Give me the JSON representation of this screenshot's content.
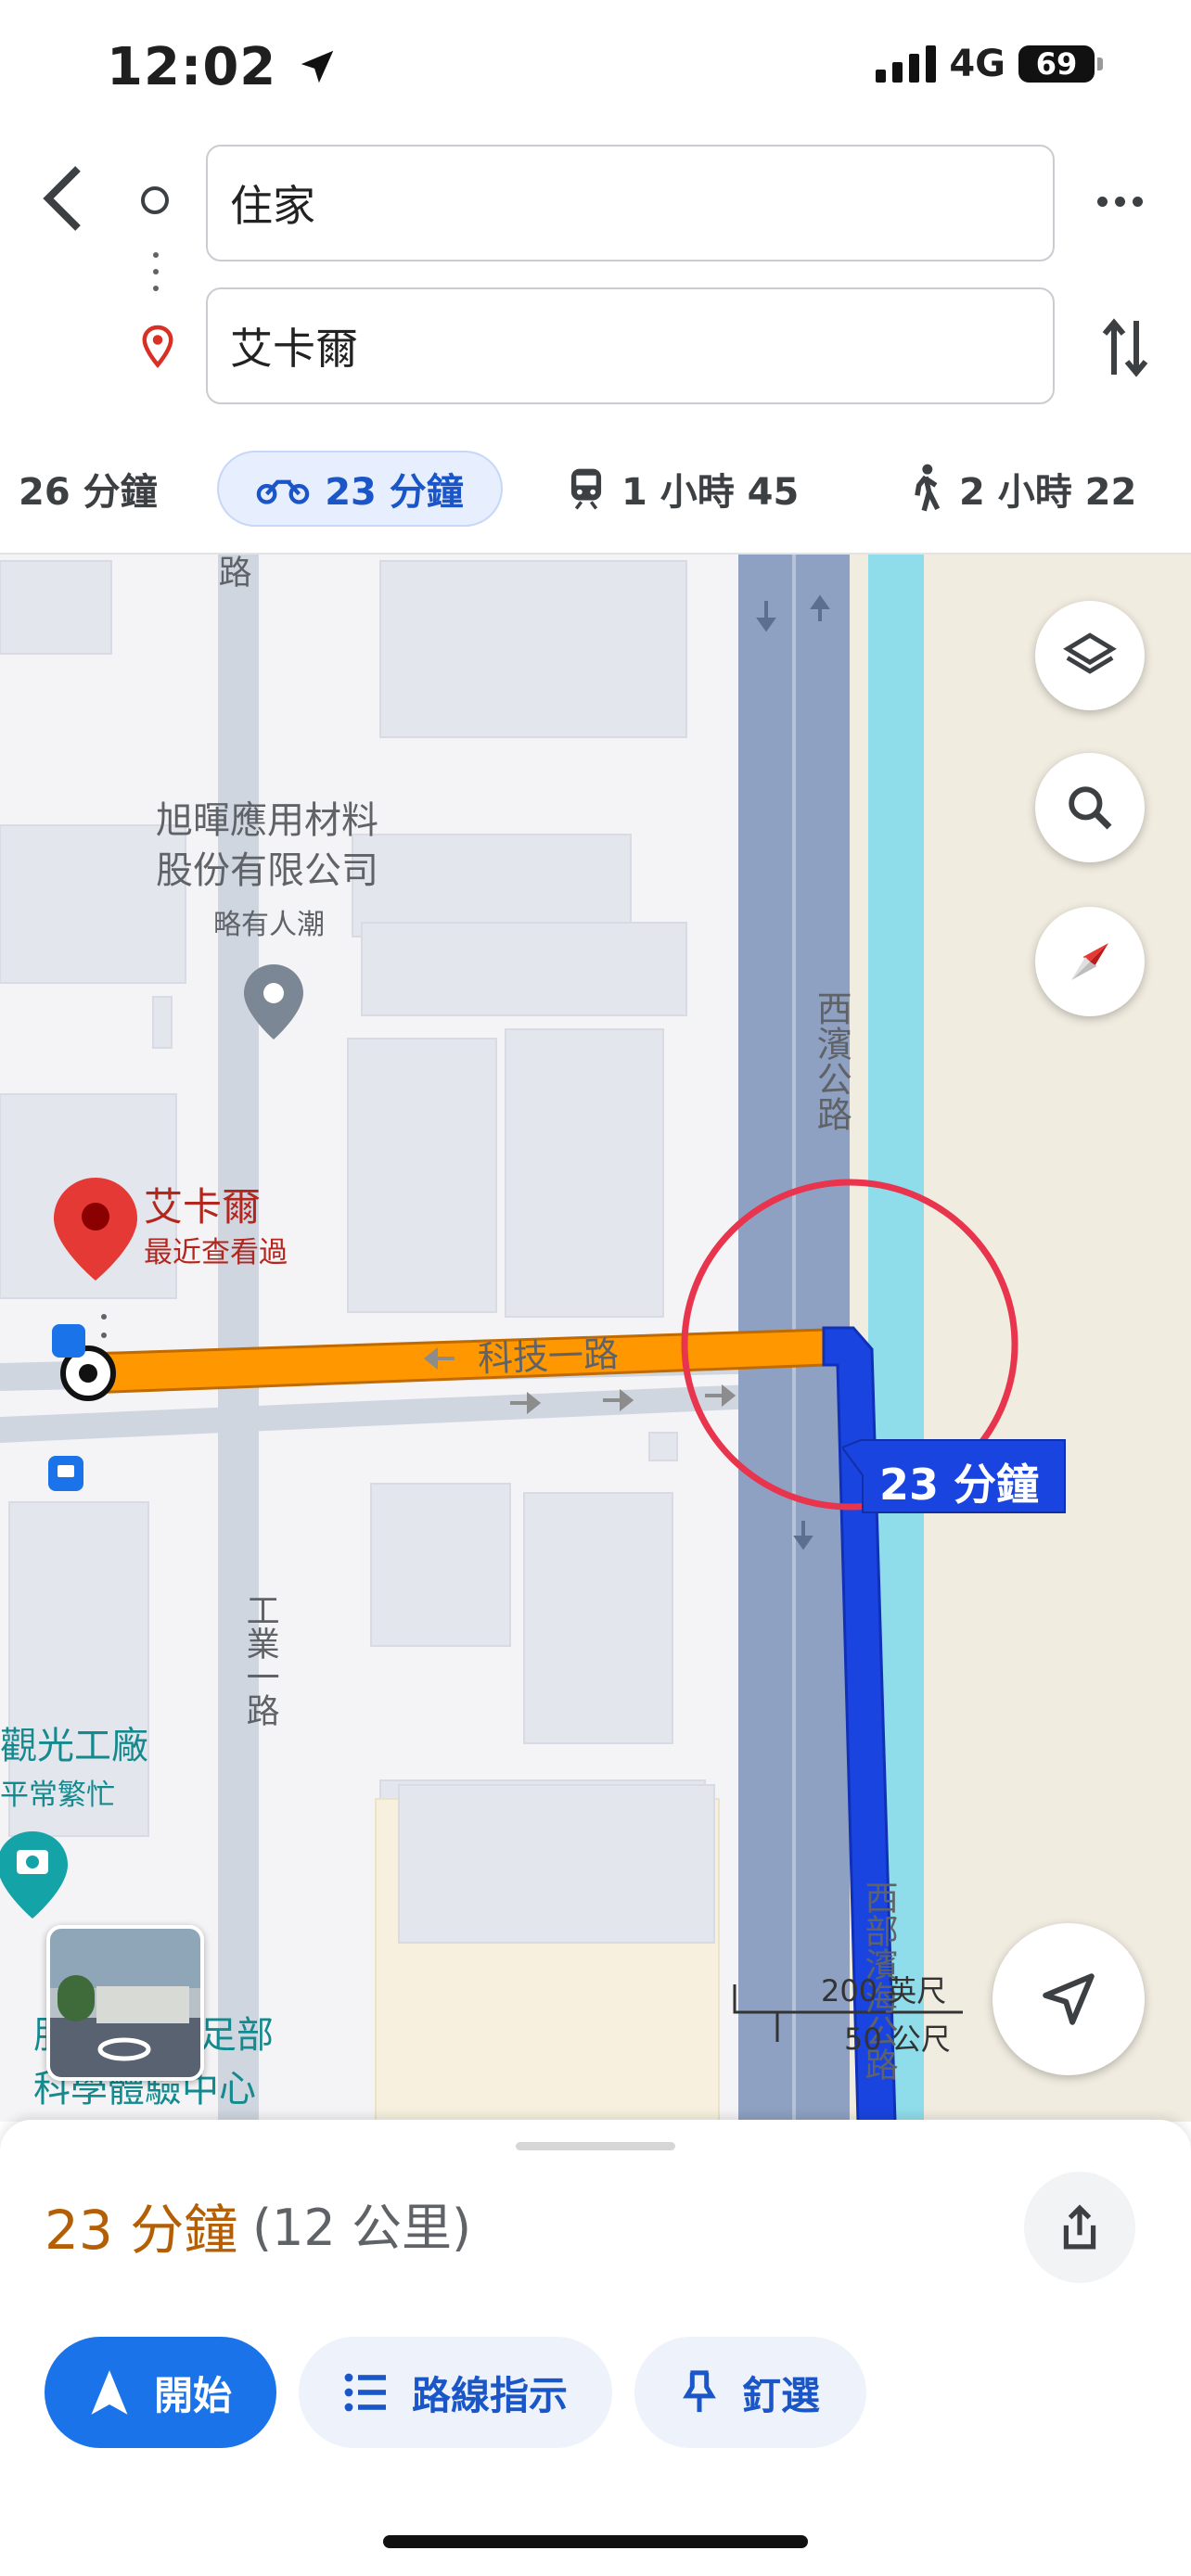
{
  "status_bar": {
    "time": "12:02",
    "network": "4G",
    "battery": "69"
  },
  "route": {
    "origin": "住家",
    "destination": "艾卡爾",
    "icons": [
      "back-arrow-icon",
      "origin-circle-icon",
      "destination-pin-icon",
      "more-icon",
      "swap-icon"
    ]
  },
  "modes": [
    {
      "label": "26 分鐘",
      "icon": "car-icon"
    },
    {
      "label": "23 分鐘",
      "icon": "motorcycle-icon",
      "selected": true
    },
    {
      "label": "1 小時 45",
      "icon": "train-icon"
    },
    {
      "label": "2 小時 22",
      "icon": "walk-icon"
    }
  ],
  "map": {
    "poi_company": "旭暉應用材料\n股份有限公司",
    "poi_company_status": "略有人潮",
    "dest_name": "艾卡爾",
    "dest_sub": "最近查看過",
    "road_keji": "科技一路",
    "road_xibin": "西濱公路",
    "road_gongye": "工業一路",
    "road_road1": "路",
    "road_xibu": "西部濱海公路",
    "poi_factory": "觀光工廠",
    "poi_factory_status": "平常繁忙",
    "poi_science_a": "肝",
    "poi_science_b": "足部",
    "poi_science_c": "科學體驗中心",
    "route_badge": "23 分鐘",
    "scale_ft": "200 英尺",
    "scale_m": "50 公尺",
    "colors": {
      "route_blue": "#1a44e0",
      "route_orange": "#ff9800",
      "highlight_ring": "#e8354d",
      "accent_blue": "#1a73e8"
    }
  },
  "sheet": {
    "duration": "23 分鐘",
    "distance": "(12 公里)",
    "start_label": "開始",
    "steps_label": "路線指示",
    "pin_label": "釘選"
  }
}
